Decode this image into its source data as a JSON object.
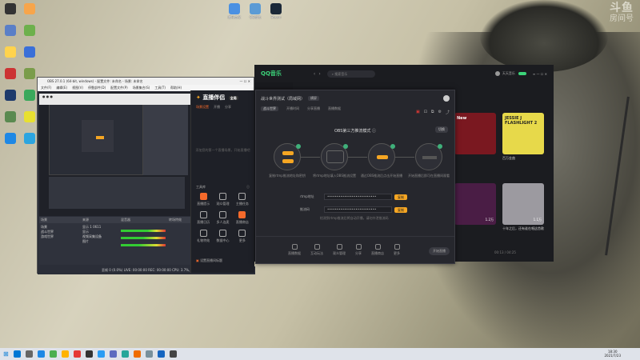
{
  "watermark": {
    "line1": "斗鱼",
    "line2": "房间号"
  },
  "desktop_icons": [
    {
      "label": "",
      "color": "#333"
    },
    {
      "label": "",
      "color": "#f7a54b"
    },
    {
      "label": "",
      "color": "#5a7fc7"
    },
    {
      "label": "",
      "color": "#6db04c"
    },
    {
      "label": "",
      "color": "#ffd34d"
    },
    {
      "label": "",
      "color": "#3a6fd8"
    },
    {
      "label": "",
      "color": "#c33"
    },
    {
      "label": "",
      "color": "#7a9c4a"
    },
    {
      "label": "",
      "color": "#1e3a6b"
    },
    {
      "label": "",
      "color": "#3aa85b"
    },
    {
      "label": "",
      "color": "#5a8a50"
    },
    {
      "label": "",
      "color": "#e8e030"
    },
    {
      "label": "",
      "color": "#1e88e5"
    },
    {
      "label": "",
      "color": "#2ca5e0"
    }
  ],
  "top_icons": [
    "腾讯会议",
    "QQ游戏",
    "Steam"
  ],
  "obs": {
    "title": "OBS 27.0.1 (64-bit, windows) - 配置文件: 未命名 - 场景: 未命名",
    "menu": [
      "文件(F)",
      "编辑(E)",
      "视图(V)",
      "停靠部件(D)",
      "配置文件(P)",
      "场景集合(S)",
      "工具(T)",
      "帮助(H)"
    ],
    "docks": [
      "场景",
      "来源",
      "混音器",
      "转场特效",
      "控件"
    ],
    "scenes": [
      "场景",
      "战斗世界",
      "游戏世界"
    ],
    "sources": [
      "显示 1 0611",
      "显示",
      "视频采集设备",
      "图片"
    ],
    "status": "丢帧 0 (0.0%)   LIVE: 00:00:00   REC: 00:00:00   CPU: 3.7%, 60.00 fps"
  },
  "zb": {
    "logo": "直播伴侣",
    "logo_badge": "全局",
    "tabs": [
      "场景设置",
      "开播",
      "分享"
    ],
    "hint": "添加您的第一个直播场景，开始直播吧",
    "section": "工具库",
    "tools": [
      {
        "label": "直播提示",
        "hot": true
      },
      {
        "label": "观众管理",
        "hot": false
      },
      {
        "label": "主播任务",
        "hot": false
      },
      {
        "label": "直播日历",
        "hot": false
      },
      {
        "label": "多人连麦",
        "hot": false
      },
      {
        "label": "直播商店",
        "hot": true
      },
      {
        "label": "礼物特效",
        "hot": false
      },
      {
        "label": "数据中心",
        "hot": false
      },
      {
        "label": "更多",
        "hot": false
      }
    ],
    "footer": "设置直播间标题"
  },
  "qq": {
    "logo": "QQ音乐",
    "search_placeholder": "搜索音乐",
    "user": "天天音乐",
    "albums": [
      {
        "caption": "",
        "color": "#7a1820",
        "badge": "New"
      },
      {
        "caption": "百万金曲",
        "color": "#e7d94a",
        "badge": "JESSIE J FLASHLIGHT 2"
      },
      {
        "caption": "",
        "color": "#4a1d45",
        "badge": ""
      },
      {
        "caption": "十年之后，还有谁在唱这首歌",
        "color": "#9c9aa0",
        "badge": ""
      }
    ],
    "counts": [
      "1.2万",
      "1.1万"
    ],
    "player_time": "00:13 / 04:25"
  },
  "dialog": {
    "title": "战斗世界测试（局域网）",
    "tag": "横屏",
    "sub_tag": "战斗世界",
    "sub_items": [
      "开播时间",
      "分享直播",
      "直播数据"
    ],
    "mode": "OBS第三方推流模式",
    "switch": "切换",
    "steps": [
      {
        "cap": "复制rtmp推流地址和密钥"
      },
      {
        "cap": "将rtmp地址填入OBS推流设置"
      },
      {
        "cap": "通过OBS推流后点击开始直播"
      },
      {
        "cap": "开始直播后即可在直播间观看"
      }
    ],
    "step_btn": "复制",
    "rtmp_label": "rtmp地址",
    "rtmp_value": "••••••••••••••••••••••••••",
    "key_label": "推流码",
    "key_value": "••••••••••••••••••••••••••",
    "copy": "复制",
    "note": "检测到rtmp推流后将自动开播，请勿外泄推流码",
    "footer_tools": [
      "直播数据",
      "互动玩法",
      "观众管理",
      "分享",
      "直播商店",
      "更多"
    ],
    "golive": "开始直播"
  },
  "taskbar": {
    "icons": [
      "#0078d4",
      "#666",
      "#1e88e5",
      "#4caf50",
      "#ffb300",
      "#e53935",
      "#333",
      "#2a9df4",
      "#5c6bc0",
      "#26a69a",
      "#ef6c00",
      "#78909c",
      "#1565c0",
      "#444"
    ],
    "time": "18:30",
    "date": "2021/7/23"
  }
}
